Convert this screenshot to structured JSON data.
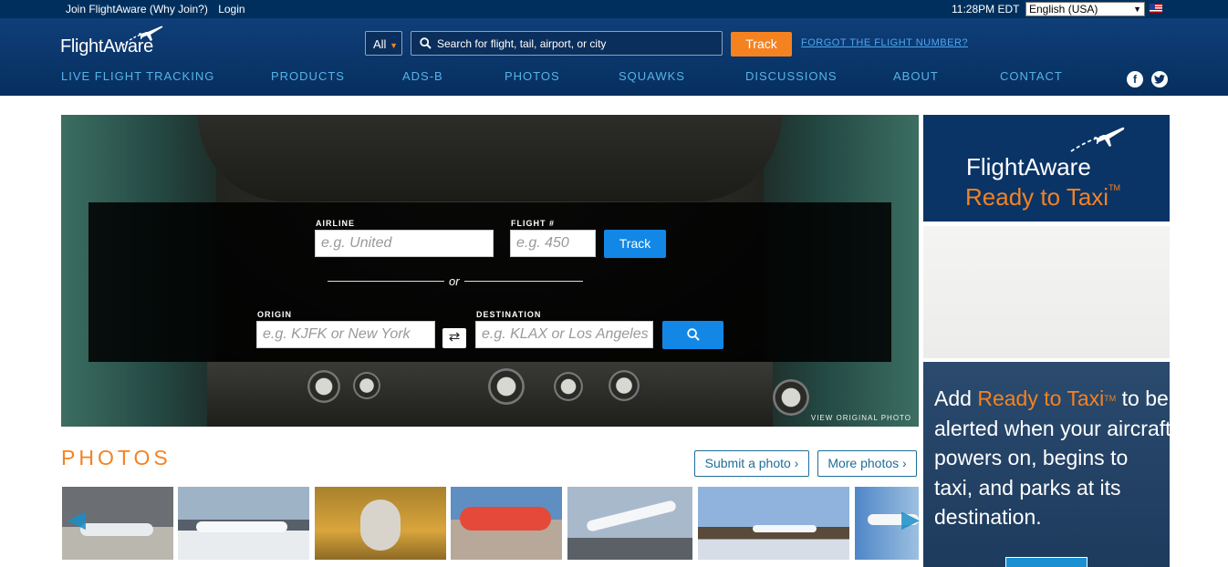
{
  "topbar": {
    "join": "Join FlightAware (Why Join?)",
    "login": "Login",
    "time": "11:28PM EDT",
    "language": "English (USA)"
  },
  "header": {
    "logo": "FlightAware",
    "all": "All",
    "search_placeholder": "Search for flight, tail, airport, or city",
    "track": "Track",
    "forgot": "FORGOT THE FLIGHT NUMBER?"
  },
  "nav": [
    "LIVE FLIGHT TRACKING",
    "PRODUCTS",
    "ADS-B",
    "PHOTOS",
    "SQUAWKS",
    "DISCUSSIONS",
    "ABOUT",
    "CONTACT"
  ],
  "hero": {
    "airline_label": "AIRLINE",
    "airline_placeholder": "e.g. United",
    "flight_label": "FLIGHT #",
    "flight_placeholder": "e.g. 450",
    "track": "Track",
    "or": "or",
    "origin_label": "ORIGIN",
    "origin_placeholder": "e.g. KJFK or New York",
    "destination_label": "DESTINATION",
    "destination_placeholder": "e.g. KLAX or Los Angeles",
    "view_original": "VIEW ORIGINAL PHOTO"
  },
  "photos": {
    "title": "PHOTOS",
    "submit": "Submit a photo ›",
    "more": "More photos ›"
  },
  "ads": {
    "ad1_line1": "FlightAware",
    "ad1_line2": "Ready to Taxi",
    "ad1_tm": "TM",
    "ad3_add": "Add ",
    "ad3_highlight": "Ready to Taxi",
    "ad3_tm": "TM",
    "ad3_rest": "to be alerted when your aircraft powers on, begins to taxi, and parks at its destination."
  },
  "colors": {
    "topbar": "#002f5d",
    "header": "#0f3e79",
    "accent_orange": "#f58220",
    "nav_link": "#56b3e8",
    "button_blue": "#1287e6"
  }
}
